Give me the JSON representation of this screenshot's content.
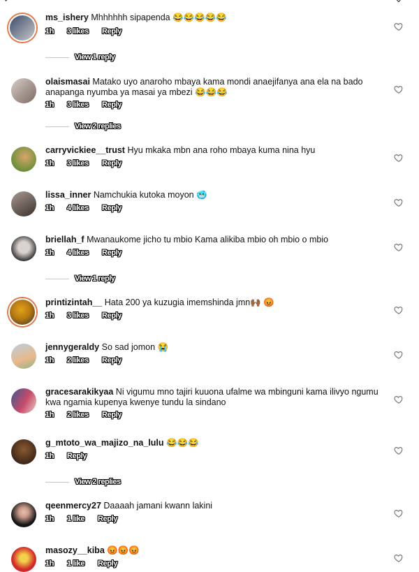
{
  "top": {
    "left_glyph": "✓",
    "right_glyph": "⌄"
  },
  "comments": [
    {
      "user": "ms_ishery",
      "text": "Mhhhhhh sipapenda 😂😂😂😂😂",
      "time": "1h",
      "likes": "3 likes",
      "reply": "Reply",
      "view_replies": "View 1 reply",
      "avatar_colors": [
        "#3a4a6b",
        "#c9c9c9"
      ]
    },
    {
      "user": "olaismasai",
      "text": "Matako uyo anaroho mbaya kama mondi anaejifanya ana ela na bado anapanga nyumba ya masai ya mbezi 😂😂😂",
      "time": "1h",
      "likes": "3 likes",
      "reply": "Reply",
      "view_replies": "View 2 replies",
      "avatar_colors": [
        "#c9b6b0",
        "#7a6a62"
      ]
    },
    {
      "user": "carryvickiee__trust",
      "text": "Hyu  mkaka mbn ana roho mbaya kuma nina hyu",
      "time": "1h",
      "likes": "3 likes",
      "reply": "Reply",
      "view_replies": "",
      "avatar_colors": [
        "#6b8f3a",
        "#d8a56a"
      ]
    },
    {
      "user": "lissa_inner",
      "text": "Namchukia kutoka moyon 🥶",
      "time": "1h",
      "likes": "4 likes",
      "reply": "Reply",
      "view_replies": "",
      "avatar_colors": [
        "#8a7a72",
        "#3b302c"
      ]
    },
    {
      "user": "briellah_f",
      "text": "Mwanaukome jicho tu mbio Kama alikiba mbio oh mbio o mbio",
      "time": "1h",
      "likes": "4 likes",
      "reply": "Reply",
      "view_replies": "View 1 reply",
      "avatar_colors": [
        "#2a2a2a",
        "#d9d3cf"
      ]
    },
    {
      "user": "printizintah__",
      "text": "Hata 200 ya kuzugia imemshinda jmn🙌🏾 😡",
      "time": "1h",
      "likes": "3 likes",
      "reply": "Reply",
      "view_replies": "",
      "avatar_colors": [
        "#e0a21a",
        "#4a3a2a"
      ]
    },
    {
      "user": "jennygeraldy",
      "text": "So sad jomon 😭",
      "time": "1h",
      "likes": "2 likes",
      "reply": "Reply",
      "view_replies": "",
      "avatar_colors": [
        "#b9cfe0",
        "#e8b98a"
      ]
    },
    {
      "user": "gracesarakikyaa",
      "text": "Ni vigumu mno tajiri kuuona ufalme wa mbinguni kama ilivyo ngumu kwa ngamia kupenya kwenye tundu la sindano",
      "time": "1h",
      "likes": "2 likes",
      "reply": "Reply",
      "view_replies": "",
      "avatar_colors": [
        "#3b5a8f",
        "#c84a6a"
      ]
    },
    {
      "user": "g_mtoto_wa_majizo_na_lulu",
      "text": "😂😂😂",
      "time": "1h",
      "likes": "",
      "reply": "Reply",
      "view_replies": "View 2 replies",
      "avatar_colors": [
        "#5a3a22",
        "#2a1a12"
      ]
    },
    {
      "user": "qeenmercy27",
      "text": "Daaaah jamani kwann lakini",
      "time": "1h",
      "likes": "1 like",
      "reply": "Reply",
      "view_replies": "",
      "avatar_colors": [
        "#141414",
        "#c89a8a"
      ]
    },
    {
      "user": "masozy__kiba",
      "text": "😡😡😡",
      "time": "1h",
      "likes": "1 like",
      "reply": "Reply",
      "view_replies": "",
      "avatar_colors": [
        "#d22a2a",
        "#f2d24a"
      ]
    }
  ],
  "colors": {
    "heart_stroke": "#7a7a7a",
    "story_ring": "#e6764a",
    "line": "#c7c7c7"
  }
}
